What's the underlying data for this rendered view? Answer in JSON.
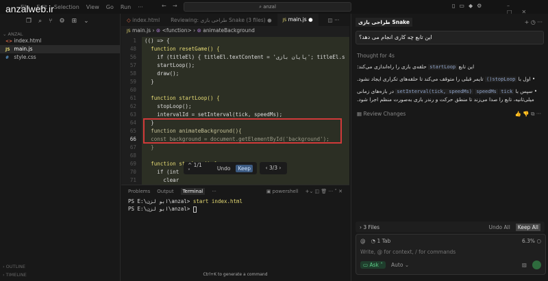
{
  "watermark": "anzalweb.ir",
  "menu": [
    "File",
    "Edit",
    "Selection",
    "View",
    "Go",
    "Run",
    "···"
  ],
  "search": "anzal",
  "explorer": {
    "folder": "ANZAL",
    "files": [
      {
        "name": "index.html",
        "icon": "<>",
        "color": "#e06c4b"
      },
      {
        "name": "main.js",
        "icon": "JS",
        "color": "#e6db74"
      },
      {
        "name": "style.css",
        "icon": "#",
        "color": "#5ea1d8"
      }
    ],
    "outline": "OUTLINE",
    "timeline": "TIMELINE"
  },
  "tabs": [
    "index.html",
    "Reviewing: طراحی بازی Snake (3 files)",
    "main.js"
  ],
  "breadcrumb": [
    "main.js",
    "<function>",
    "animateBackground"
  ],
  "code": [
    {
      "n": "1",
      "t": "(() => {"
    },
    {
      "n": "48",
      "t": "  function resetGame() {"
    },
    {
      "n": "56",
      "t": "    if (titleEl) { titleEl.textContent = 'پایان بازی'; titleEl.s"
    },
    {
      "n": "57",
      "t": "    startLoop();"
    },
    {
      "n": "58",
      "t": "    draw();"
    },
    {
      "n": "59",
      "t": "  }"
    },
    {
      "n": "60",
      "t": ""
    },
    {
      "n": "61",
      "t": "  function startLoop() {"
    },
    {
      "n": "62",
      "t": "    stopLoop();"
    },
    {
      "n": "63",
      "t": "    intervalId = setInterval(tick, speedMs);"
    },
    {
      "n": "64",
      "t": "  }"
    },
    {
      "n": "65",
      "t": "  function animateBackground(){"
    },
    {
      "n": "66",
      "t": "  const background = document.getElementById('background');"
    },
    {
      "n": "67",
      "t": "  }"
    },
    {
      "n": "68",
      "t": ""
    },
    {
      "n": "69",
      "t": "  function stopLoop() {"
    },
    {
      "n": "70",
      "t": "    if (int"
    },
    {
      "n": "71",
      "t": "      clear"
    },
    {
      "n": "72",
      "t": "      intervalId = null;"
    }
  ],
  "diff": {
    "count": "^ 1/1 ˅",
    "undo": "Undo",
    "keep": "Keep",
    "nav": "‹ 3/3 ›"
  },
  "panel": {
    "tabs": [
      "Problems",
      "Output",
      "Terminal",
      "···"
    ],
    "shell": "powershell",
    "lines": [
      {
        "prompt": "PS E:\\ابو لزن\\anzal> ",
        "cmd": "start index.html"
      },
      {
        "prompt": "PS E:\\ابو لزن\\anzal> ",
        "cmd": ""
      }
    ],
    "hint": "Ctrl+K to generate a command"
  },
  "chat": {
    "title": "طراحی بازی Snake",
    "question": "این تابع چه کاری انجام می دهد؟",
    "thought": "Thought for 4s",
    "intro": {
      "pre": "این تابع",
      "code": "startLoop",
      "post": "حلقه‌ی بازی را راه‌اندازی می‌کند:"
    },
    "bullets": [
      {
        "pre": "اول با",
        "code": "stopLoop()",
        "post": "تایمر قبلی را متوقف می‌کند تا حلقه‌های تکراری ایجاد نشود."
      },
      {
        "pre": "سپس با",
        "code": "setInterval(tick, speedMs)",
        "code2": "speedMs",
        "code3": "tick",
        "post": "در بازه‌های زمانی میلی‌ثانیه، تابع را صدا می‌زند تا منطق حرکت و رندر بازی به‌صورت منظم اجرا شود."
      }
    ],
    "review": "Review Changes",
    "files": "3 Files",
    "undo_all": "Undo All",
    "keep_all": "Keep All",
    "context": "1 Tab",
    "usage": "6.3%",
    "placeholder": "Write, @ for context, / for commands",
    "mode": "Ask",
    "model": "Auto"
  }
}
